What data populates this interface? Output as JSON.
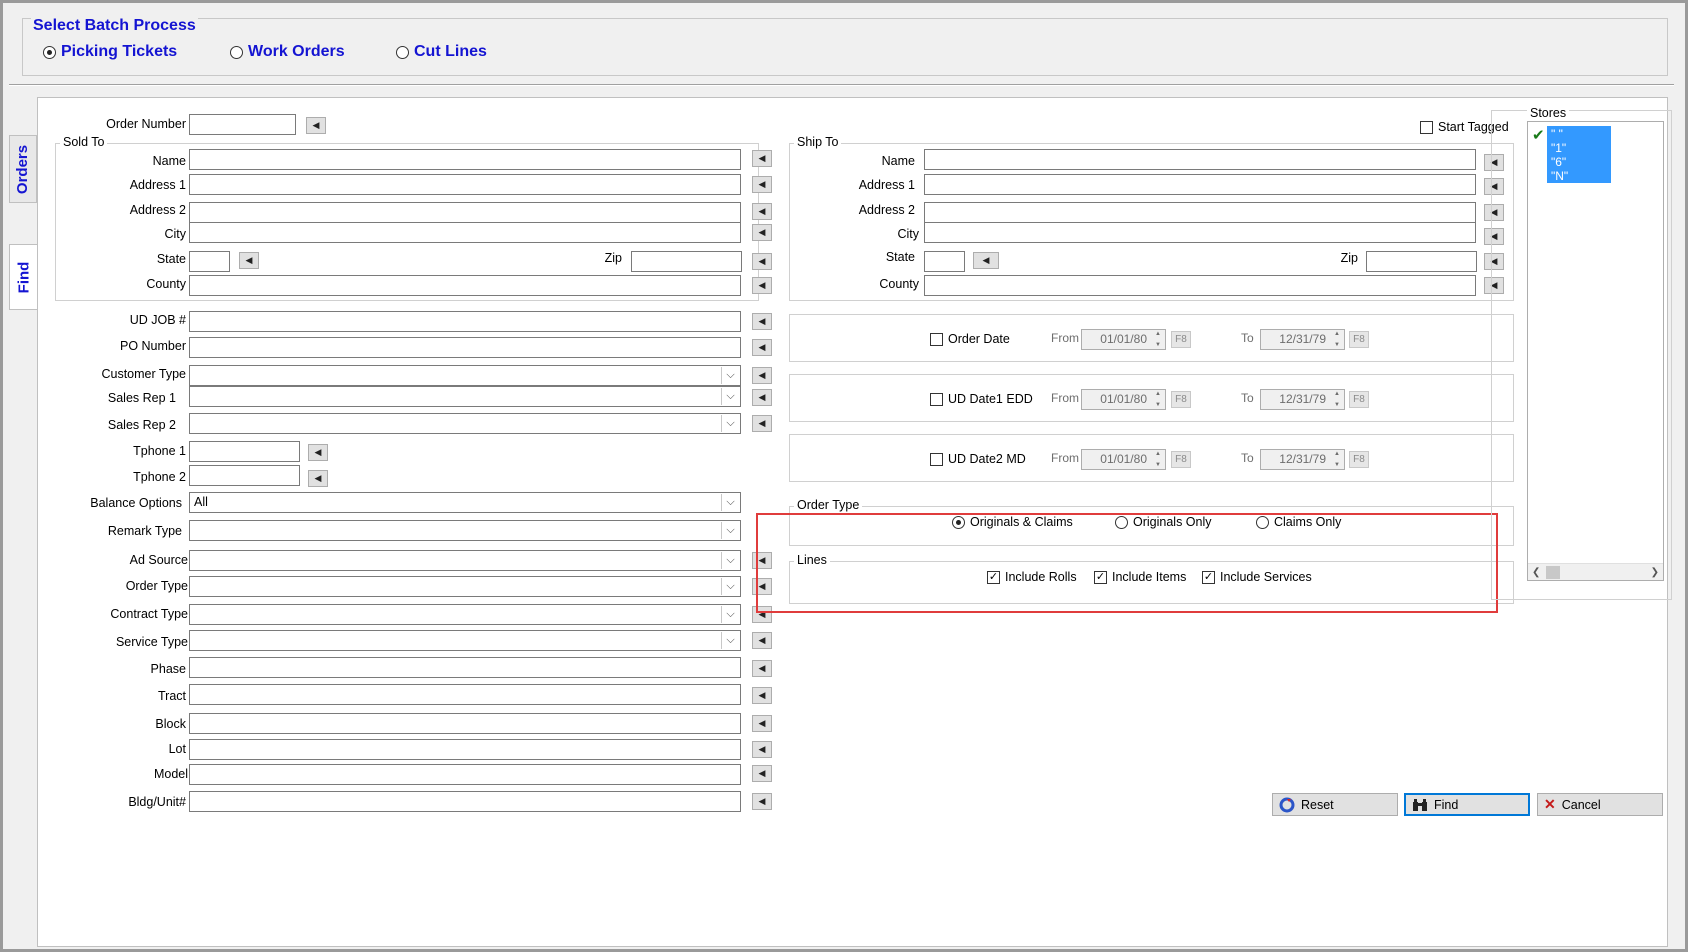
{
  "batch_process": {
    "title": "Select Batch Process",
    "options": [
      {
        "label": "Picking Tickets",
        "selected": true
      },
      {
        "label": "Work Orders",
        "selected": false
      },
      {
        "label": "Cut Lines",
        "selected": false
      }
    ]
  },
  "tabs": {
    "orders": "Orders",
    "find": "Find"
  },
  "left": {
    "order_number": "Order Number",
    "sold_to": "Sold To",
    "name": "Name",
    "address1": "Address 1",
    "address2": "Address 2",
    "city": "City",
    "state": "State",
    "zip": "Zip",
    "county": "County",
    "ud_job": "UD JOB #",
    "po_number": "PO Number",
    "customer_type": "Customer Type",
    "sales_rep1": "Sales Rep 1",
    "sales_rep2": "Sales Rep 2",
    "tphone1": "Tphone 1",
    "tphone2": "Tphone 2",
    "balance_options": "Balance Options",
    "balance_value": "All",
    "remark_type": "Remark Type",
    "ad_source": "Ad Source",
    "order_type": "Order Type",
    "contract_type": "Contract Type",
    "service_type": "Service Type",
    "phase": "Phase",
    "tract": "Tract",
    "block": "Block",
    "lot": "Lot",
    "model": "Model",
    "bldg_unit": "Bldg/Unit#"
  },
  "right": {
    "start_tagged": "Start Tagged",
    "ship_to": "Ship To",
    "name": "Name",
    "address1": "Address 1",
    "address2": "Address 2",
    "city": "City",
    "state": "State",
    "zip": "Zip",
    "county": "County"
  },
  "dates": [
    {
      "label": "Order Date",
      "from_label": "From",
      "from": "01/01/80",
      "to_label": "To",
      "to": "12/31/79",
      "f8": "F8"
    },
    {
      "label": "UD Date1 EDD",
      "from_label": "From",
      "from": "01/01/80",
      "to_label": "To",
      "to": "12/31/79",
      "f8": "F8"
    },
    {
      "label": "UD Date2 MD",
      "from_label": "From",
      "from": "01/01/80",
      "to_label": "To",
      "to": "12/31/79",
      "f8": "F8"
    }
  ],
  "order_type": {
    "title": "Order Type",
    "options": [
      {
        "label": "Originals & Claims",
        "selected": true
      },
      {
        "label": "Originals Only",
        "selected": false
      },
      {
        "label": "Claims Only",
        "selected": false
      }
    ]
  },
  "lines": {
    "title": "Lines",
    "include_rolls": "Include Rolls",
    "include_items": "Include Items",
    "include_services": "Include Services"
  },
  "stores": {
    "title": "Stores",
    "items": [
      "\" \"",
      "\"1\"",
      "\"6\"",
      "\"N\""
    ]
  },
  "buttons": {
    "reset": "Reset",
    "find": "Find",
    "cancel": "Cancel"
  },
  "colors": {
    "accent": "#1414d2",
    "selection": "#3399ff",
    "highlight_box": "#e03c3c"
  }
}
